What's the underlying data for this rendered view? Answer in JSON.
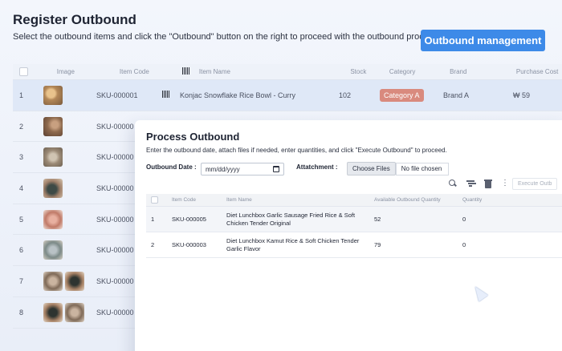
{
  "page": {
    "title": "Register Outbound",
    "subtitle": "Select the outbound items and click the \"Outbound\" button on the right to proceed with the outbound process.",
    "primary_button": "Outbound management"
  },
  "bg_table": {
    "columns": [
      "Image",
      "Item Code",
      "Item Name",
      "Stock",
      "Category",
      "Brand",
      "Purchase Cost"
    ],
    "rows": [
      {
        "num": "1",
        "code": "SKU-000001",
        "name": "Konjac Snowflake Rice Bowl - Curry",
        "stock": "102",
        "category": "Category A",
        "brand": "Brand A",
        "price": "₩ 59"
      },
      {
        "num": "2",
        "code": "SKU-00000"
      },
      {
        "num": "3",
        "code": "SKU-00000"
      },
      {
        "num": "4",
        "code": "SKU-00000"
      },
      {
        "num": "5",
        "code": "SKU-00000"
      },
      {
        "num": "6",
        "code": "SKU-00000"
      },
      {
        "num": "7",
        "code": "SKU-00000"
      },
      {
        "num": "8",
        "code": "SKU-00000"
      }
    ]
  },
  "modal": {
    "title": "Process Outbound",
    "description": "Enter the outbound date, attach files if needed, enter quantities, and click \"Execute Outbound\" to proceed.",
    "date_label": "Outbound Date :",
    "date_placeholder": "mm/dd/yyyy",
    "attach_label": "Attatchment :",
    "file_button": "Choose Files",
    "file_status": "No file chosen",
    "execute_button": "Execute Outb",
    "columns": [
      "Item Code",
      "Item Name",
      "Available Outbound Quantity",
      "Quantity"
    ],
    "rows": [
      {
        "num": "1",
        "code": "SKU-000005",
        "name": "Diet Lunchbox Garlic Sausage Fried Rice & Soft Chicken Tender Original",
        "available": "52",
        "qty": "0"
      },
      {
        "num": "2",
        "code": "SKU-000003",
        "name": "Diet Lunchbox Kamut Rice & Soft Chicken Tender Garlic Flavor",
        "available": "79",
        "qty": "0"
      }
    ]
  },
  "icons": [
    "search-icon",
    "filter-icon",
    "trash-icon",
    "more-icon",
    "calendar-icon",
    "barcode-icon",
    "cursor-icon"
  ],
  "colors": {
    "accent": "#3d8ae8",
    "category_badge": "#d98a7e",
    "selected_row": "#dfe8f7"
  }
}
